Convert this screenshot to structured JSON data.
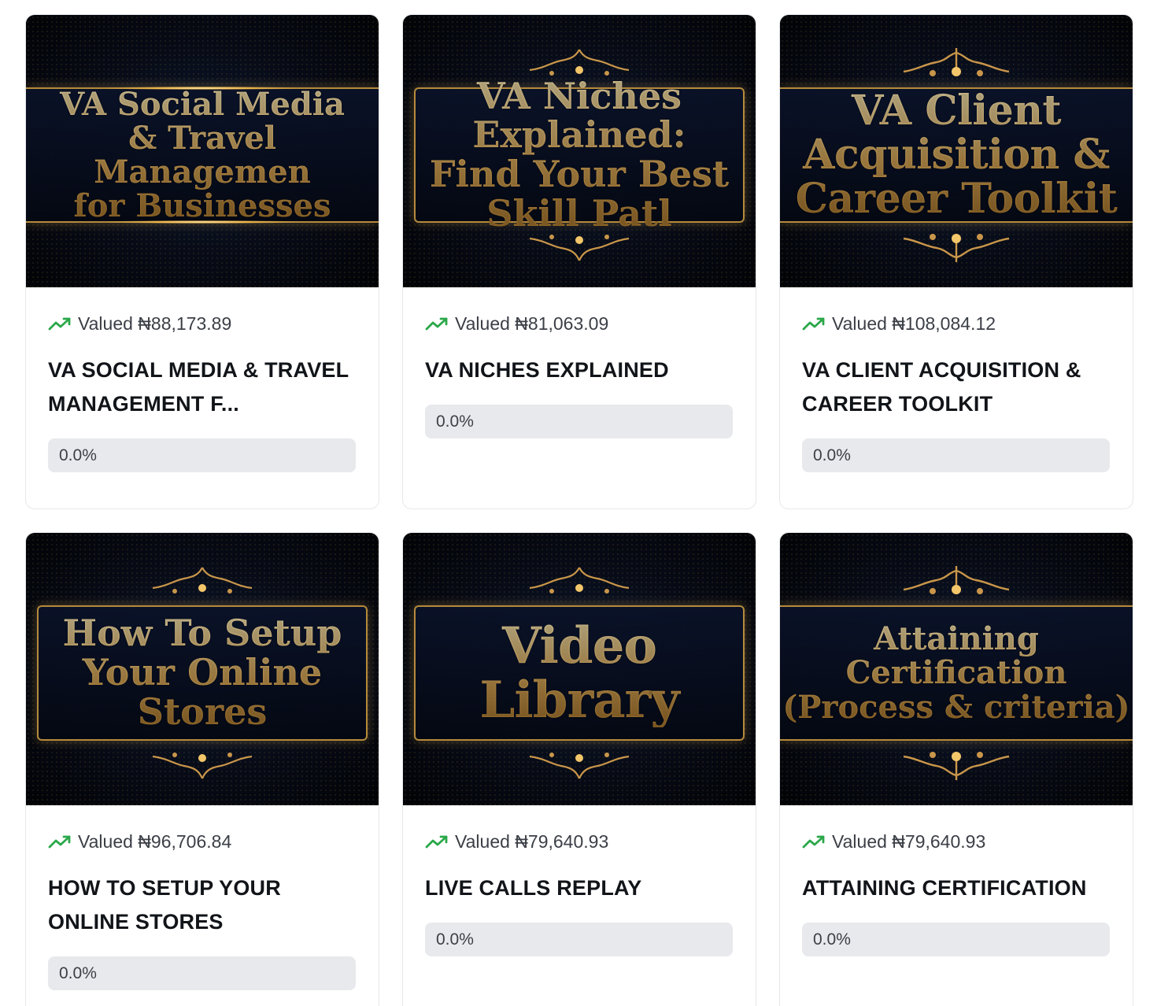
{
  "colors": {
    "accent_green": "#2ba84a",
    "text_dark": "#111418",
    "text_muted": "#3b3f46",
    "progress_track": "#e8e9ec",
    "gold": "#e6be72"
  },
  "icons": {
    "valued": "trending-up-icon"
  },
  "courses": [
    {
      "thumbnail_text": "VA Social Media\n& Travel Managemen\nfor Businesses",
      "valued": "Valued ₦88,173.89",
      "title": "VA SOCIAL MEDIA & TRAVEL MANAGEMENT F...",
      "progress_label": "0.0%",
      "progress_value": 0
    },
    {
      "thumbnail_text": "VA Niches Explained:\nFind Your Best Skill Patl",
      "valued": "Valued ₦81,063.09",
      "title": "VA NICHES EXPLAINED",
      "progress_label": "0.0%",
      "progress_value": 0
    },
    {
      "thumbnail_text": "VA Client\nAcquisition &\nCareer Toolkit",
      "valued": "Valued ₦108,084.12",
      "title": "VA CLIENT ACQUISITION & CAREER TOOLKIT",
      "progress_label": "0.0%",
      "progress_value": 0
    },
    {
      "thumbnail_text": "How To Setup\nYour Online Stores",
      "valued": "Valued ₦96,706.84",
      "title": "HOW TO SETUP YOUR ONLINE STORES",
      "progress_label": "0.0%",
      "progress_value": 0
    },
    {
      "thumbnail_text": "Video Library",
      "valued": "Valued ₦79,640.93",
      "title": "LIVE CALLS REPLAY",
      "progress_label": "0.0%",
      "progress_value": 0
    },
    {
      "thumbnail_text": "Attaining Certification\n(Process & criteria)",
      "valued": "Valued ₦79,640.93",
      "title": "ATTAINING CERTIFICATION",
      "progress_label": "0.0%",
      "progress_value": 0
    }
  ]
}
